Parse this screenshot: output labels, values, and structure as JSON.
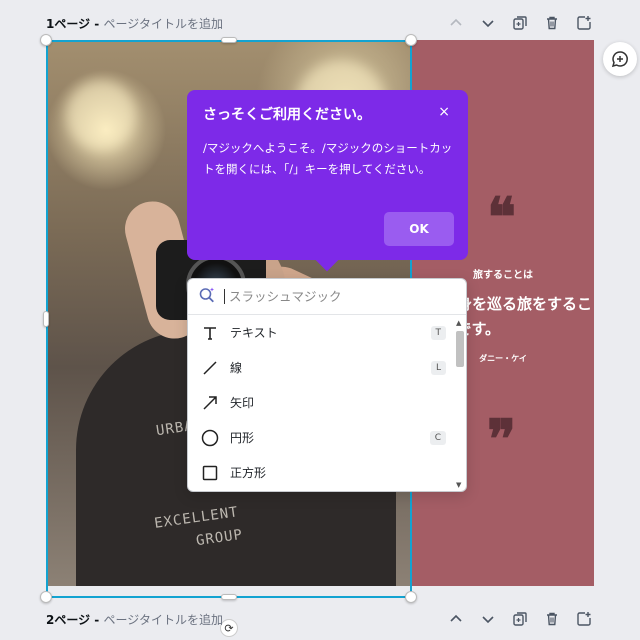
{
  "page1_header": {
    "page": "1ページ",
    "separator": " - ",
    "add_title": "ページタイトルを追加"
  },
  "page2_header": {
    "page": "2ページ",
    "separator": " - ",
    "add_title": "ページタイトルを追加"
  },
  "design": {
    "small_heading": "旅することは",
    "main_text": "自身を巡る旅をすることです。",
    "author": "ダニー・ケイ",
    "open_quote": "❝",
    "close_quote": "❞",
    "shirt_text_1": "EXCELLENT",
    "shirt_text_2": "GROUP",
    "shirt_text_3": "URBAN",
    "panel_color": "#a45d65"
  },
  "tooltip": {
    "title": "さっそくご利用ください。",
    "close": "×",
    "body": "/マジックへようこそ。/マジックのショートカットを開くには、「/」キーを押してください。",
    "ok_label": "OK",
    "color": "#7d2ae8"
  },
  "magic_menu": {
    "search_placeholder": "スラッシュマジック",
    "items": [
      {
        "label": "テキスト",
        "shortcut": "T",
        "icon": "text-icon"
      },
      {
        "label": "線",
        "shortcut": "L",
        "icon": "line-icon"
      },
      {
        "label": "矢印",
        "shortcut": "",
        "icon": "arrow-icon"
      },
      {
        "label": "円形",
        "shortcut": "C",
        "icon": "circle-icon"
      },
      {
        "label": "正方形",
        "shortcut": "",
        "icon": "square-icon"
      }
    ]
  },
  "accent_color": "#13a3d1"
}
